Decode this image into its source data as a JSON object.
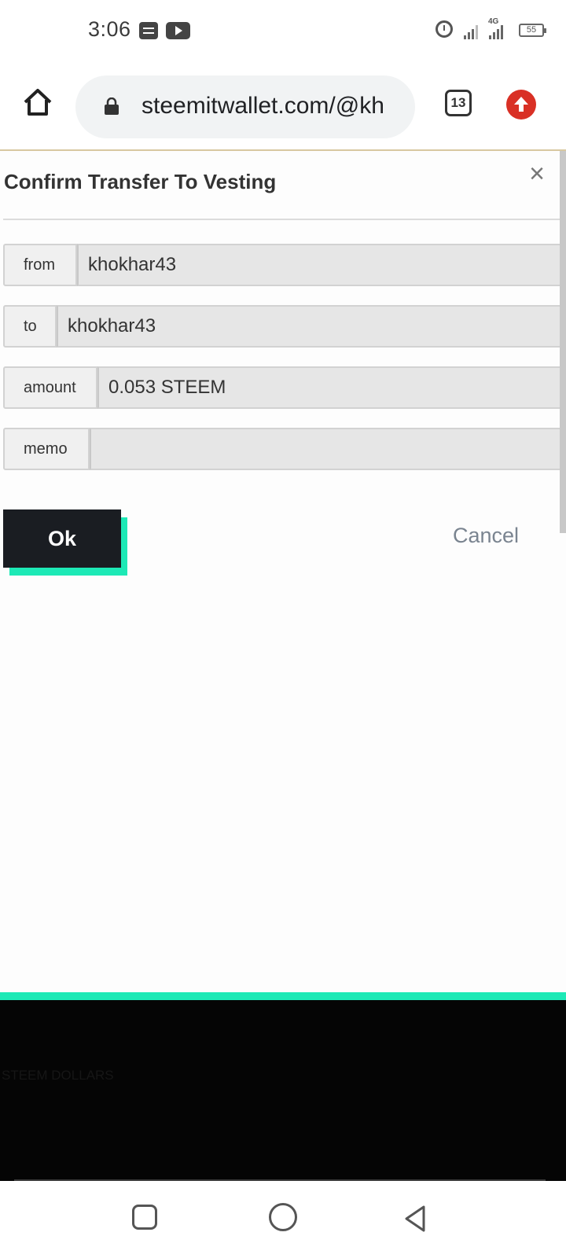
{
  "status_bar": {
    "time": "3:06",
    "network_type": "4G",
    "battery": "55",
    "icons": [
      "notification-doc-icon",
      "youtube-icon",
      "alarm-icon",
      "signal-icon",
      "signal-icon",
      "battery-icon"
    ]
  },
  "browser": {
    "url": "steemitwallet.com/@kh",
    "tab_count": "13",
    "icons": [
      "home-icon",
      "lock-icon",
      "tabs-icon",
      "update-icon"
    ]
  },
  "dialog": {
    "title": "Confirm Transfer To Vesting",
    "close_icon": "×",
    "fields": [
      {
        "label": "from",
        "value": "khokhar43"
      },
      {
        "label": "to",
        "value": "khokhar43"
      },
      {
        "label": "amount",
        "value": "0.053 STEEM"
      },
      {
        "label": "memo",
        "value": ""
      }
    ],
    "ok_label": "Ok",
    "cancel_label": "Cancel"
  },
  "underlying_page": {
    "lines": [
      "STEEM DOLLARS"
    ]
  },
  "colors": {
    "accent": "#1de9b6",
    "ok_bg": "#1a1d22",
    "update": "#d93025"
  },
  "nav": {
    "icons": [
      "recent-apps-icon",
      "home-circle-icon",
      "back-icon"
    ]
  }
}
